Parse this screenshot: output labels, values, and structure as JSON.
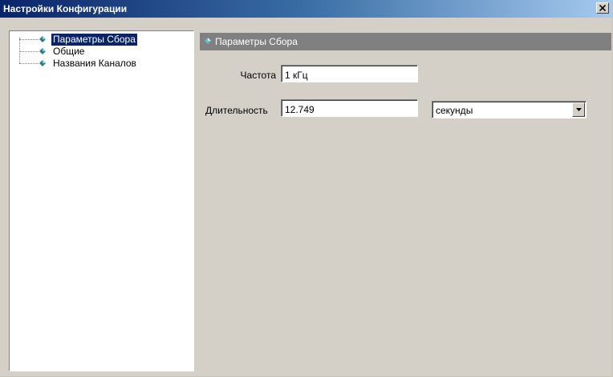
{
  "window": {
    "title": "Настройки Конфигурации",
    "close_glyph": "✕"
  },
  "tree": {
    "items": [
      {
        "label": "Параметры Сбора",
        "selected": true
      },
      {
        "label": "Общие",
        "selected": false
      },
      {
        "label": "Названия Каналов",
        "selected": false
      }
    ]
  },
  "panel": {
    "header_title": "Параметры Сбора",
    "frequency_label": "Частота",
    "frequency_value": "1 кГц",
    "duration_label": "Длительность",
    "duration_value": "12.749",
    "duration_unit": "секунды"
  },
  "colors": {
    "title_gradient_start": "#0a246a",
    "selection": "#0a246a",
    "gem_icon": "#2e7d8c",
    "panel_header": "#808080",
    "dialog_face": "#d4d0c8"
  }
}
